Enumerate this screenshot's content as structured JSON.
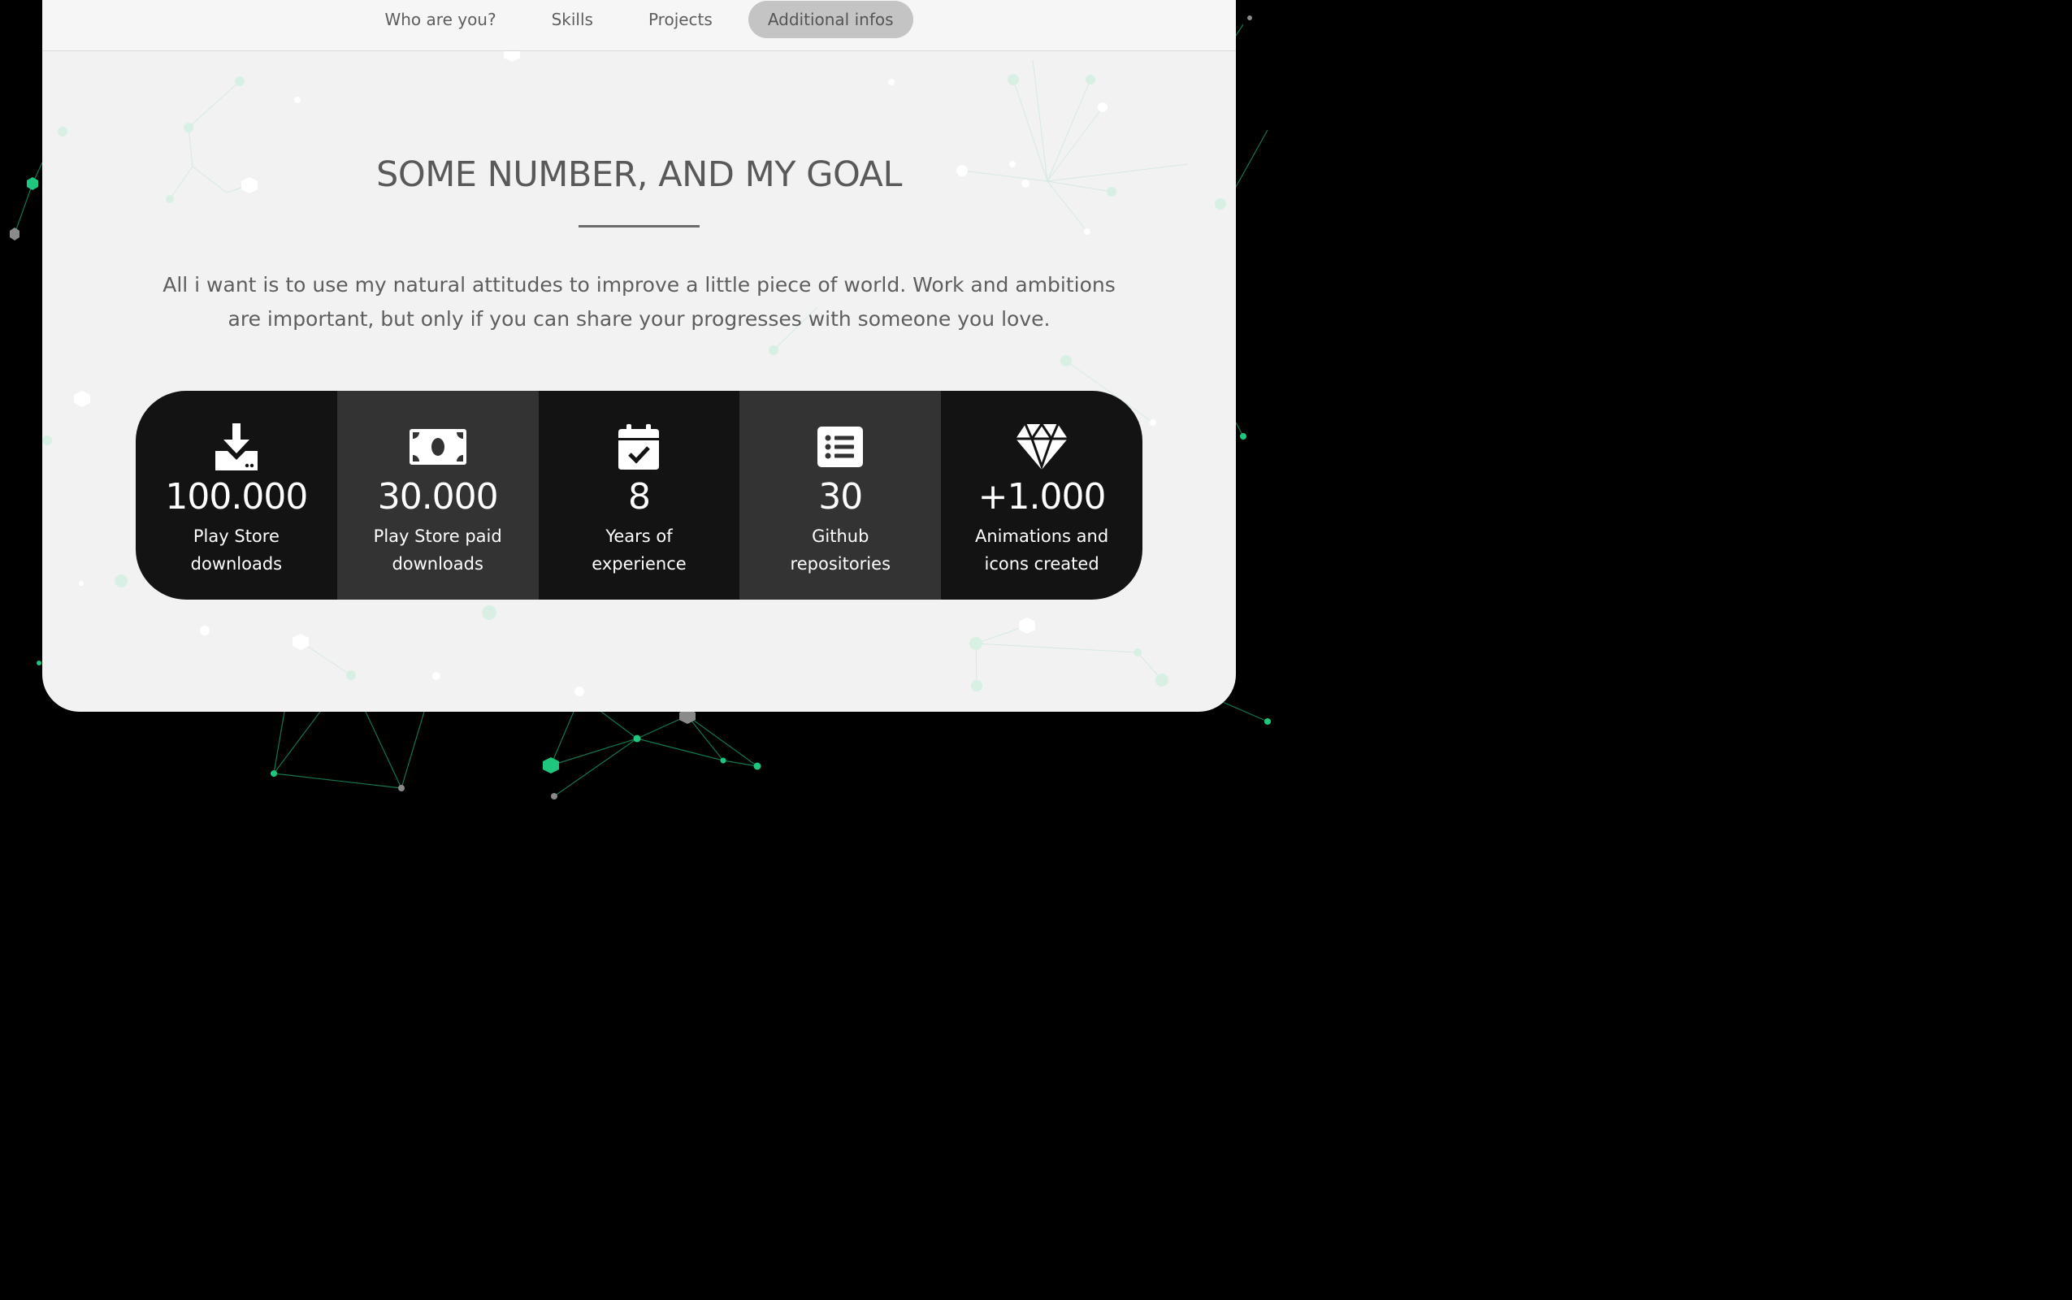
{
  "nav": {
    "items": [
      {
        "label": "Who are you?",
        "active": false
      },
      {
        "label": "Skills",
        "active": false
      },
      {
        "label": "Projects",
        "active": false
      },
      {
        "label": "Additional infos",
        "active": true
      }
    ]
  },
  "section": {
    "title": "SOME NUMBER, AND MY GOAL",
    "description": "All i want is to use my natural attitudes to improve a little piece of world. Work and ambitions are important, but only if you can share your progresses with someone you love."
  },
  "stats": [
    {
      "icon": "download-icon",
      "value": "100.000",
      "label_line1": "Play Store",
      "label_line2": "downloads"
    },
    {
      "icon": "money-bill-icon",
      "value": "30.000",
      "label_line1": "Play Store paid",
      "label_line2": "downloads"
    },
    {
      "icon": "calendar-check-icon",
      "value": "8",
      "label_line1": "Years of",
      "label_line2": "experience"
    },
    {
      "icon": "list-icon",
      "value": "30",
      "label_line1": "Github",
      "label_line2": "repositories"
    },
    {
      "icon": "diamond-icon",
      "value": "+1.000",
      "label_line1": "Animations and",
      "label_line2": "icons created"
    }
  ],
  "colors": {
    "background": "#000000",
    "card": "#f2f2f2",
    "stat_dark": "#131313",
    "stat_mid": "#333333",
    "accent_green": "#1fc77e"
  }
}
